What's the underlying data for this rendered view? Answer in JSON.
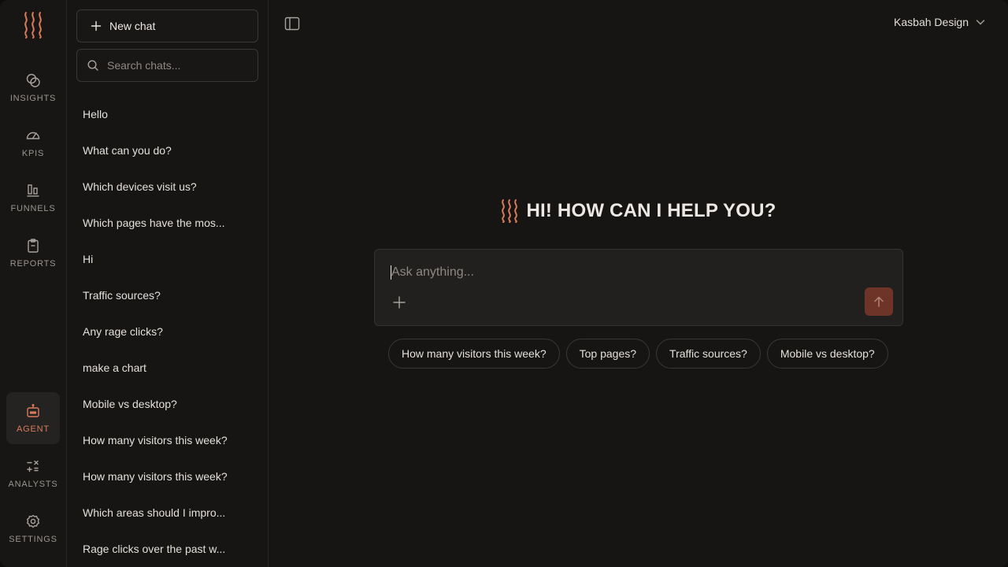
{
  "rail": {
    "items": [
      {
        "label": "INSIGHTS",
        "icon": "insights-icon"
      },
      {
        "label": "KPIS",
        "icon": "gauge-icon"
      },
      {
        "label": "FUNNELS",
        "icon": "funnel-bars-icon"
      },
      {
        "label": "REPORTS",
        "icon": "clipboard-icon"
      },
      {
        "label": "AGENT",
        "icon": "robot-icon",
        "active": true
      },
      {
        "label": "ANALYSTS",
        "icon": "calculator-icon"
      },
      {
        "label": "SETTINGS",
        "icon": "gear-icon"
      }
    ]
  },
  "sidebar": {
    "new_chat_label": "New chat",
    "search_placeholder": "Search chats...",
    "chats": [
      "Hello",
      "What can you do?",
      "Which devices visit us?",
      "Which pages have the mos...",
      "Hi",
      "Traffic sources?",
      "Any rage clicks?",
      "make a chart",
      "Mobile vs desktop?",
      "How many visitors this week?",
      "How many visitors this week?",
      "Which areas should I impro...",
      "Rage clicks over the past w..."
    ]
  },
  "header": {
    "workspace": "Kasbah Design"
  },
  "main": {
    "greeting": "HI! HOW CAN I HELP YOU?",
    "composer_placeholder": "Ask anything...",
    "suggestions": [
      "How many visitors this week?",
      "Top pages?",
      "Traffic sources?",
      "Mobile vs desktop?"
    ]
  },
  "colors": {
    "accent": "#d97b5a",
    "background": "#161514",
    "send_button": "#6e3427"
  }
}
